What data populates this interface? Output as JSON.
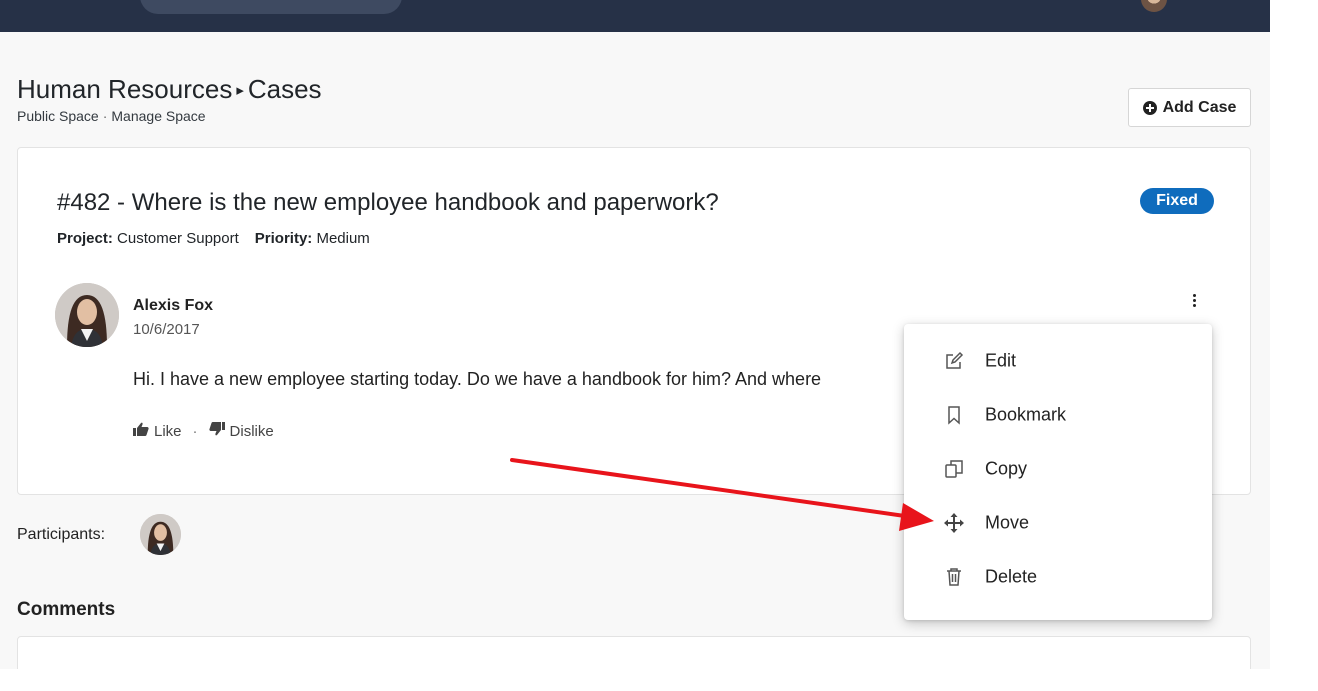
{
  "header": {
    "breadcrumb_parent": "Human Resources",
    "breadcrumb_separator": "▸",
    "breadcrumb_current": "Cases",
    "subnav": {
      "public_space": "Public Space",
      "separator": "·",
      "manage_space": "Manage Space"
    },
    "add_case_label": "Add Case"
  },
  "case": {
    "title": "#482 - Where is the new employee handbook and paperwork?",
    "status": "Fixed",
    "project_label": "Project:",
    "project_value": "Customer Support",
    "priority_label": "Priority:",
    "priority_value": "Medium"
  },
  "post": {
    "author": "Alexis Fox",
    "date": "10/6/2017",
    "body": "Hi. I have a new employee starting today. Do we have a handbook for him? And where",
    "like_label": "Like",
    "reaction_separator": "·",
    "dislike_label": "Dislike"
  },
  "participants": {
    "label": "Participants:"
  },
  "comments": {
    "title": "Comments"
  },
  "context_menu": {
    "items": [
      {
        "label": "Edit",
        "icon": "edit-icon"
      },
      {
        "label": "Bookmark",
        "icon": "bookmark-icon"
      },
      {
        "label": "Copy",
        "icon": "copy-icon"
      },
      {
        "label": "Move",
        "icon": "move-icon"
      },
      {
        "label": "Delete",
        "icon": "trash-icon"
      }
    ]
  },
  "colors": {
    "navbar": "#263147",
    "badge": "#0f6cbd",
    "arrow": "#e8141b",
    "page_bg": "#f8f8f8"
  }
}
